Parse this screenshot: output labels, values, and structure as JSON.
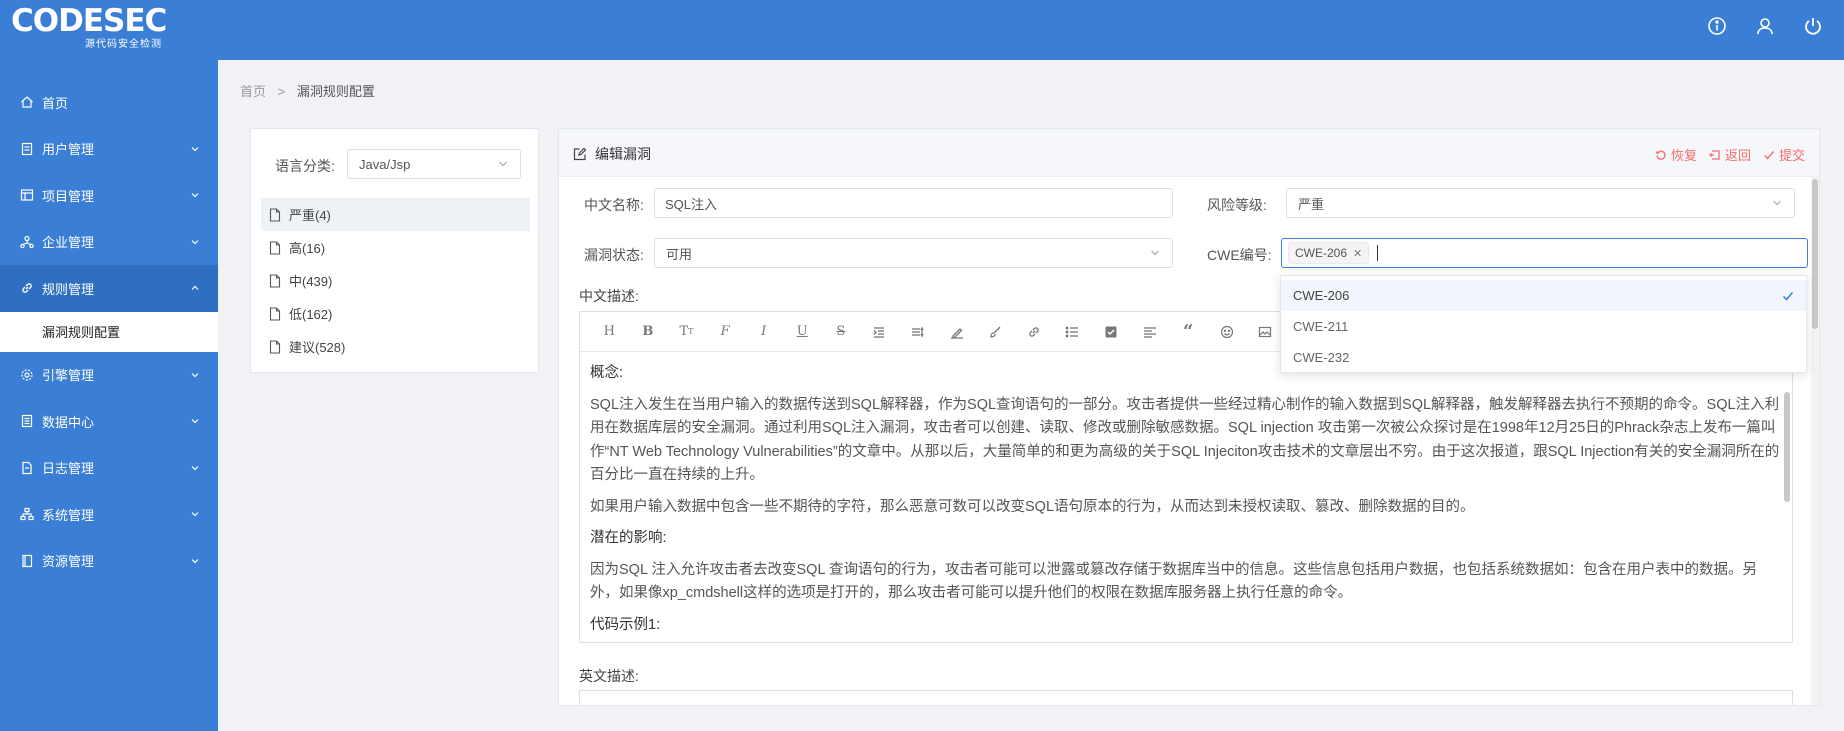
{
  "brand": {
    "name": "CODESEC",
    "tagline": "源代码安全检测"
  },
  "header_icons": [
    "info-icon",
    "user-icon",
    "power-icon"
  ],
  "sidebar": {
    "items": [
      {
        "label": "首页",
        "icon": "home-icon",
        "has_children": false
      },
      {
        "label": "用户管理",
        "icon": "doc-icon",
        "has_children": true
      },
      {
        "label": "项目管理",
        "icon": "grid-icon",
        "has_children": true
      },
      {
        "label": "企业管理",
        "icon": "org-icon",
        "has_children": true
      },
      {
        "label": "规则管理",
        "icon": "link-icon",
        "has_children": true,
        "expanded": true
      },
      {
        "label": "引擎管理",
        "icon": "gear-icon",
        "has_children": true
      },
      {
        "label": "数据中心",
        "icon": "data-icon",
        "has_children": true
      },
      {
        "label": "日志管理",
        "icon": "log-icon",
        "has_children": true
      },
      {
        "label": "系统管理",
        "icon": "sys-icon",
        "has_children": true
      },
      {
        "label": "资源管理",
        "icon": "book-icon",
        "has_children": true
      }
    ],
    "active_sub": "漏洞规则配置"
  },
  "breadcrumb": {
    "home": "首页",
    "sep": ">",
    "current": "漏洞规则配置"
  },
  "left_panel": {
    "lang_label": "语言分类:",
    "lang_value": "Java/Jsp",
    "tree": [
      "严重(4)",
      "高(16)",
      "中(439)",
      "低(162)",
      "建议(528)"
    ]
  },
  "editor_panel": {
    "title": "编辑漏洞",
    "actions": {
      "restore": "恢复",
      "back": "返回",
      "submit": "提交"
    },
    "fields": {
      "cn_name_label": "中文名称:",
      "cn_name_value": "SQL注入",
      "risk_label": "风险等级:",
      "risk_value": "严重",
      "status_label": "漏洞状态:",
      "status_value": "可用",
      "cwe_label": "CWE编号:",
      "cwe_tag": "CWE-206"
    },
    "cwe_options": [
      "CWE-206",
      "CWE-211",
      "CWE-232"
    ],
    "cn_desc_label": "中文描述:",
    "en_desc_label": "英文描述:",
    "content": {
      "p1_head": "概念:",
      "p1": "SQL注入发生在当用户输入的数据传送到SQL解释器，作为SQL查询语句的一部分。攻击者提供一些经过精心制作的输入数据到SQL解释器，触发解释器去执行不预期的命令。SQL注入利用在数据库层的安全漏洞。通过利用SQL注入漏洞，攻击者可以创建、读取、修改或删除敏感数据。SQL injection 攻击第一次被公众探讨是在1998年12月25日的Phrack杂志上发布一篇叫作“NT Web Technology Vulnerabilities”的文章中。从那以后，大量简单的和更为高级的关于SQL Injeciton攻击技术的文章层出不穷。由于这次报道，跟SQL Injection有关的安全漏洞所在的百分比一直在持续的上升。",
      "p2": "如果用户输入数据中包含一些不期待的字符，那么恶意可数可以改变SQL语句原本的行为，从而达到未授权读取、篡改、删除数据的目的。",
      "p3_head": "潜在的影响:",
      "p3": "因为SQL 注入允许攻击者去改变SQL 查询语句的行为，攻击者可能可以泄露或篡改存储于数据库当中的信息。这些信息包括用户数据，也包括系统数据如：包含在用户表中的数据。另外，如果像xp_cmdshell这样的选项是打开的，那么攻击者可能可以提升他们的权限在数据库服务器上执行任意的命令。",
      "p4_head": "代码示例1:"
    }
  },
  "colors": {
    "primary": "#3a7fd5",
    "danger": "#f56c6c"
  }
}
